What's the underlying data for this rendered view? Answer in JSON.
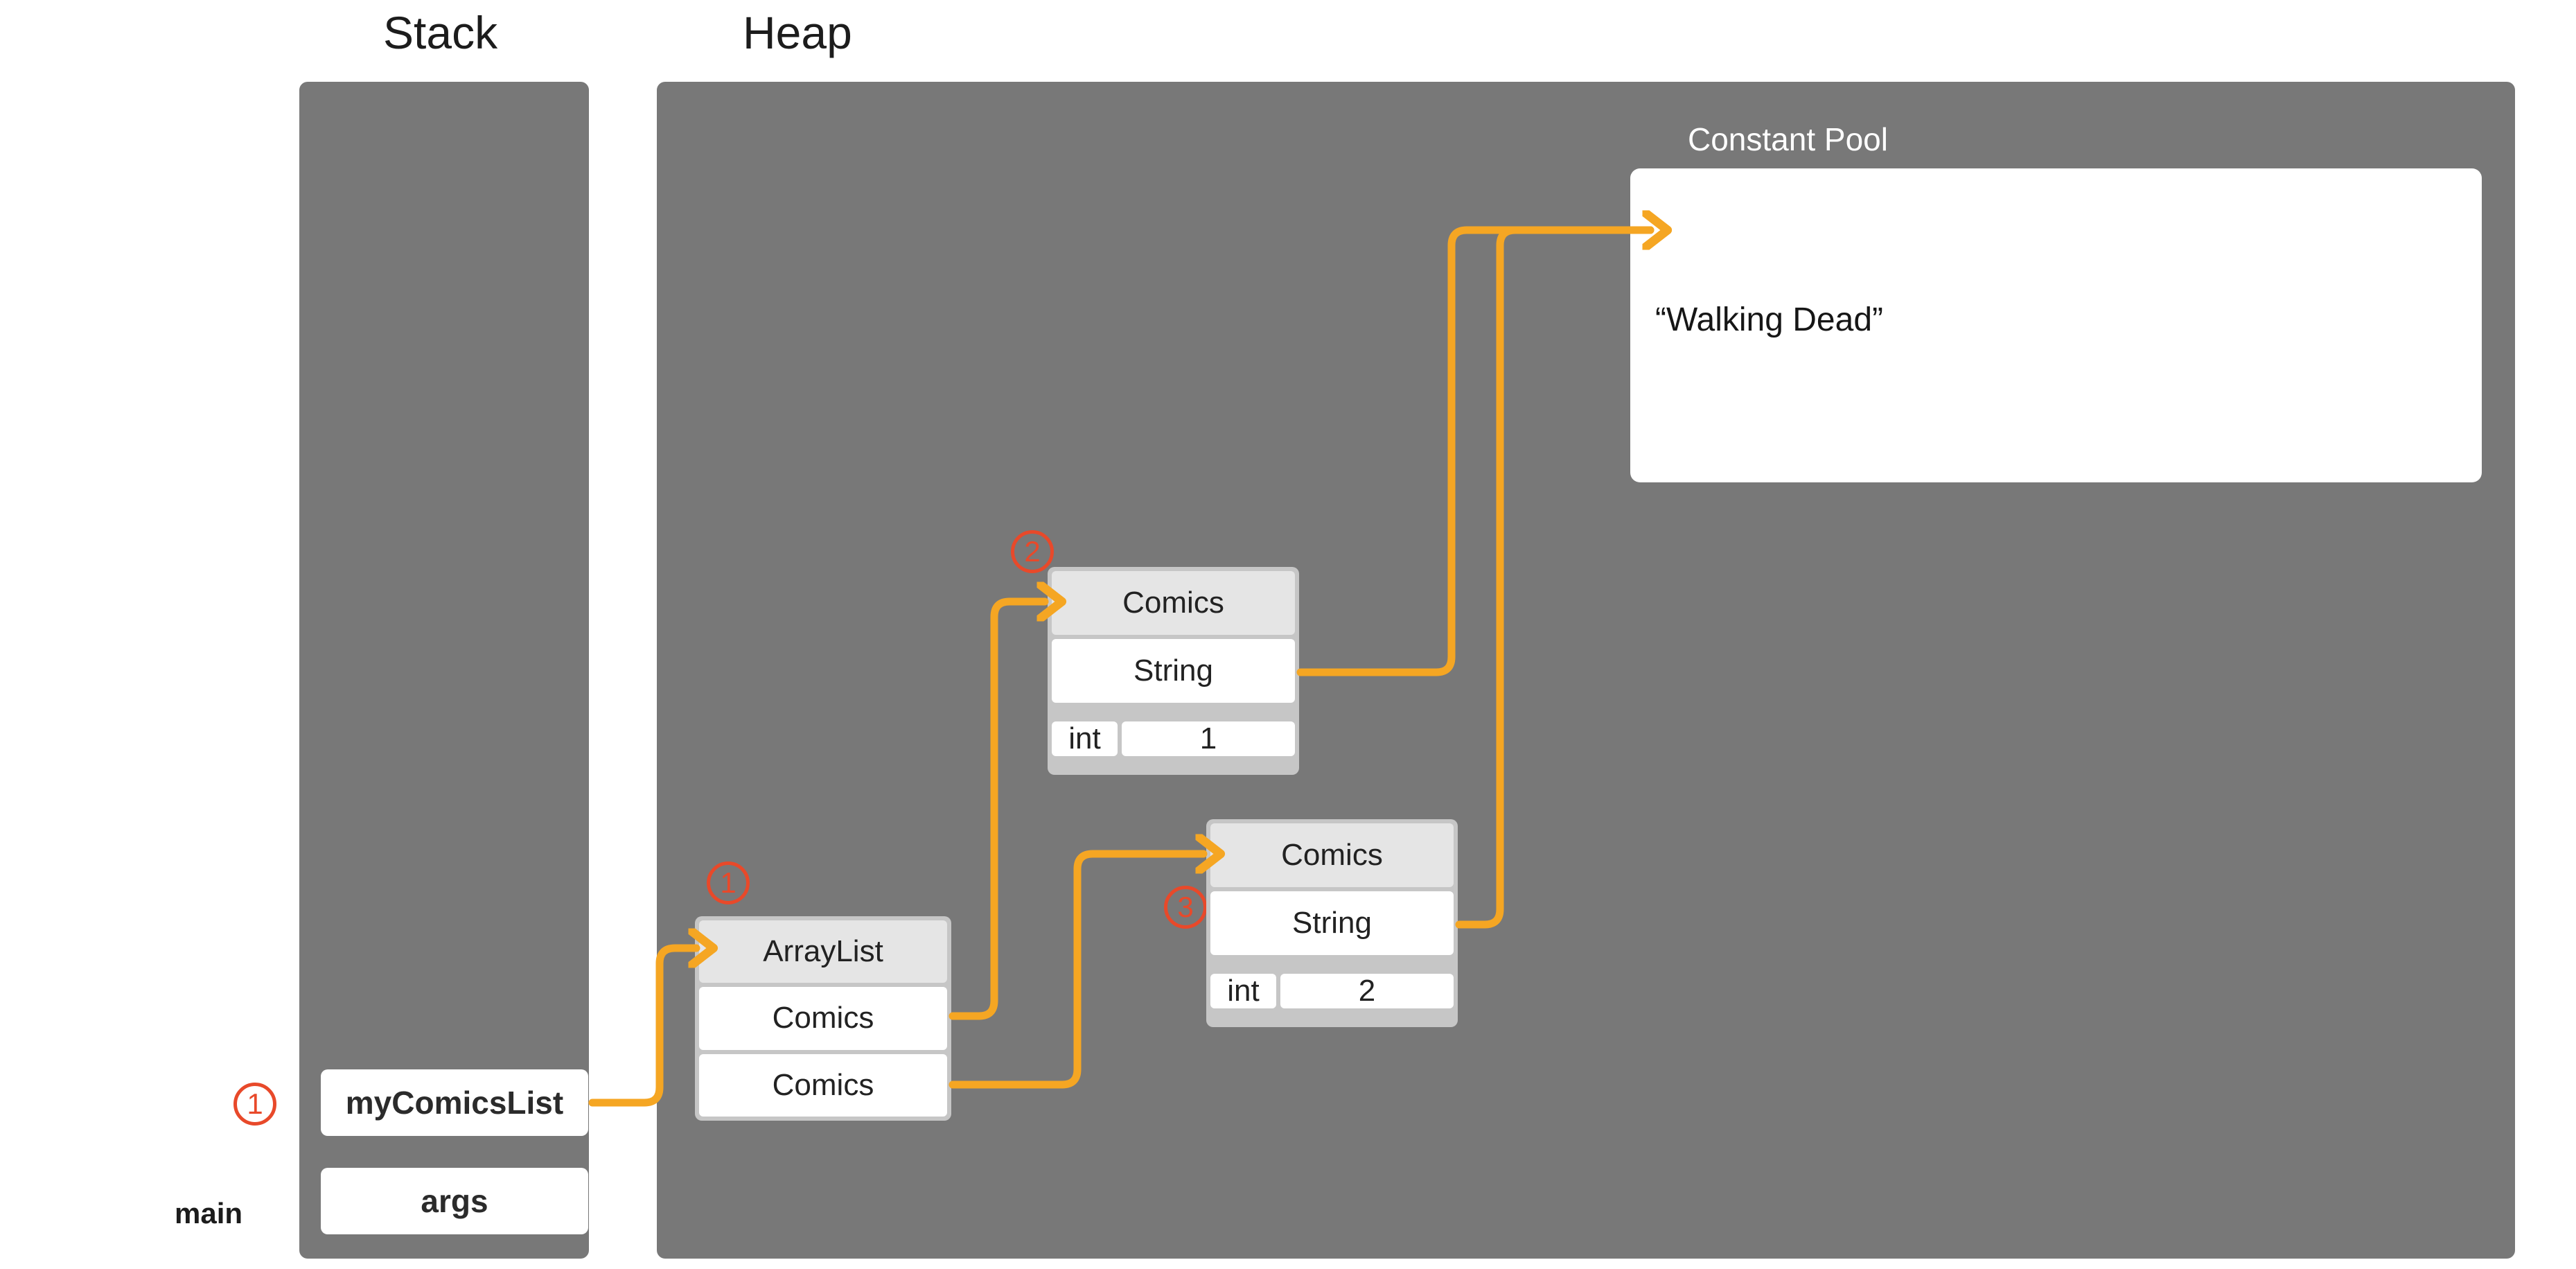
{
  "regions": {
    "stack": {
      "title": "Stack"
    },
    "heap": {
      "title": "Heap"
    }
  },
  "constant_pool": {
    "label": "Constant Pool",
    "entries": [
      {
        "value": "“Walking Dead”"
      }
    ]
  },
  "stack_frame": {
    "name": "main",
    "marker": "1",
    "variables": [
      {
        "name": "myComicsList"
      },
      {
        "name": "args"
      }
    ]
  },
  "heap_objects": [
    {
      "id": "arraylist",
      "marker": "1",
      "type": "ArrayList",
      "fields": [
        {
          "type": "Comics"
        },
        {
          "type": "Comics"
        }
      ]
    },
    {
      "id": "comics-1",
      "marker": "2",
      "type": "Comics",
      "fields": [
        {
          "type": "String"
        },
        {
          "type": "int",
          "value": "1"
        }
      ]
    },
    {
      "id": "comics-2",
      "marker": "3",
      "type": "Comics",
      "fields": [
        {
          "type": "String"
        },
        {
          "type": "int",
          "value": "2"
        }
      ]
    }
  ],
  "colors": {
    "arrow": "#f5a623",
    "marker": "#e8492a",
    "region_background": "#787878",
    "object_border": "#c6c6c6",
    "object_header": "#e5e5e5",
    "cell_background": "#ffffff",
    "page_background": "#ffffff",
    "text": "#222222",
    "label_on_region": "#ffffff"
  },
  "references": [
    {
      "from": "stack.myComicsList",
      "to": "heap.arraylist"
    },
    {
      "from": "heap.arraylist.field0",
      "to": "heap.comics-1"
    },
    {
      "from": "heap.arraylist.field1",
      "to": "heap.comics-2"
    },
    {
      "from": "heap.comics-1.String",
      "to": "constant_pool.Walking Dead"
    },
    {
      "from": "heap.comics-2.String",
      "to": "constant_pool.Walking Dead"
    }
  ]
}
